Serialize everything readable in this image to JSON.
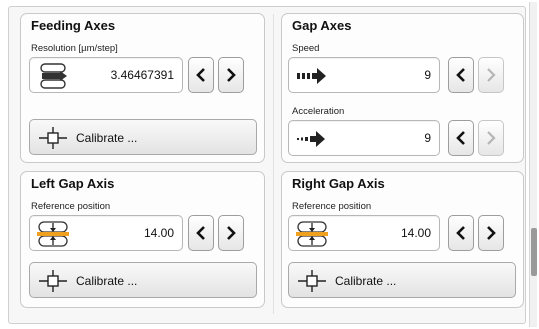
{
  "feeding_axes": {
    "title": "Feeding Axes",
    "resolution_label": "Resolution [µm/step]",
    "resolution_value": "3.46467391",
    "calibrate_label": "Calibrate ..."
  },
  "gap_axes": {
    "title": "Gap Axes",
    "speed_label": "Speed",
    "speed_value": "9",
    "acceleration_label": "Acceleration",
    "acceleration_value": "9"
  },
  "left_gap_axis": {
    "title": "Left Gap Axis",
    "reference_label": "Reference position",
    "reference_value": "14.00",
    "calibrate_label": "Calibrate ..."
  },
  "right_gap_axis": {
    "title": "Right Gap Axis",
    "reference_label": "Reference position",
    "reference_value": "14.00",
    "calibrate_label": "Calibrate ..."
  },
  "icons": {
    "decrement": "chevron-left-icon",
    "increment": "chevron-right-icon",
    "calibrate": "crosshair-icon",
    "resolution": "rollers-icon",
    "speed": "speed-arrow-icon",
    "acceleration": "acceleration-arrow-icon",
    "reference": "gap-reference-icon"
  },
  "colors": {
    "accent_orange": "#f0a020",
    "text": "#111111",
    "disabled_arrow": "#b5b5b5"
  }
}
